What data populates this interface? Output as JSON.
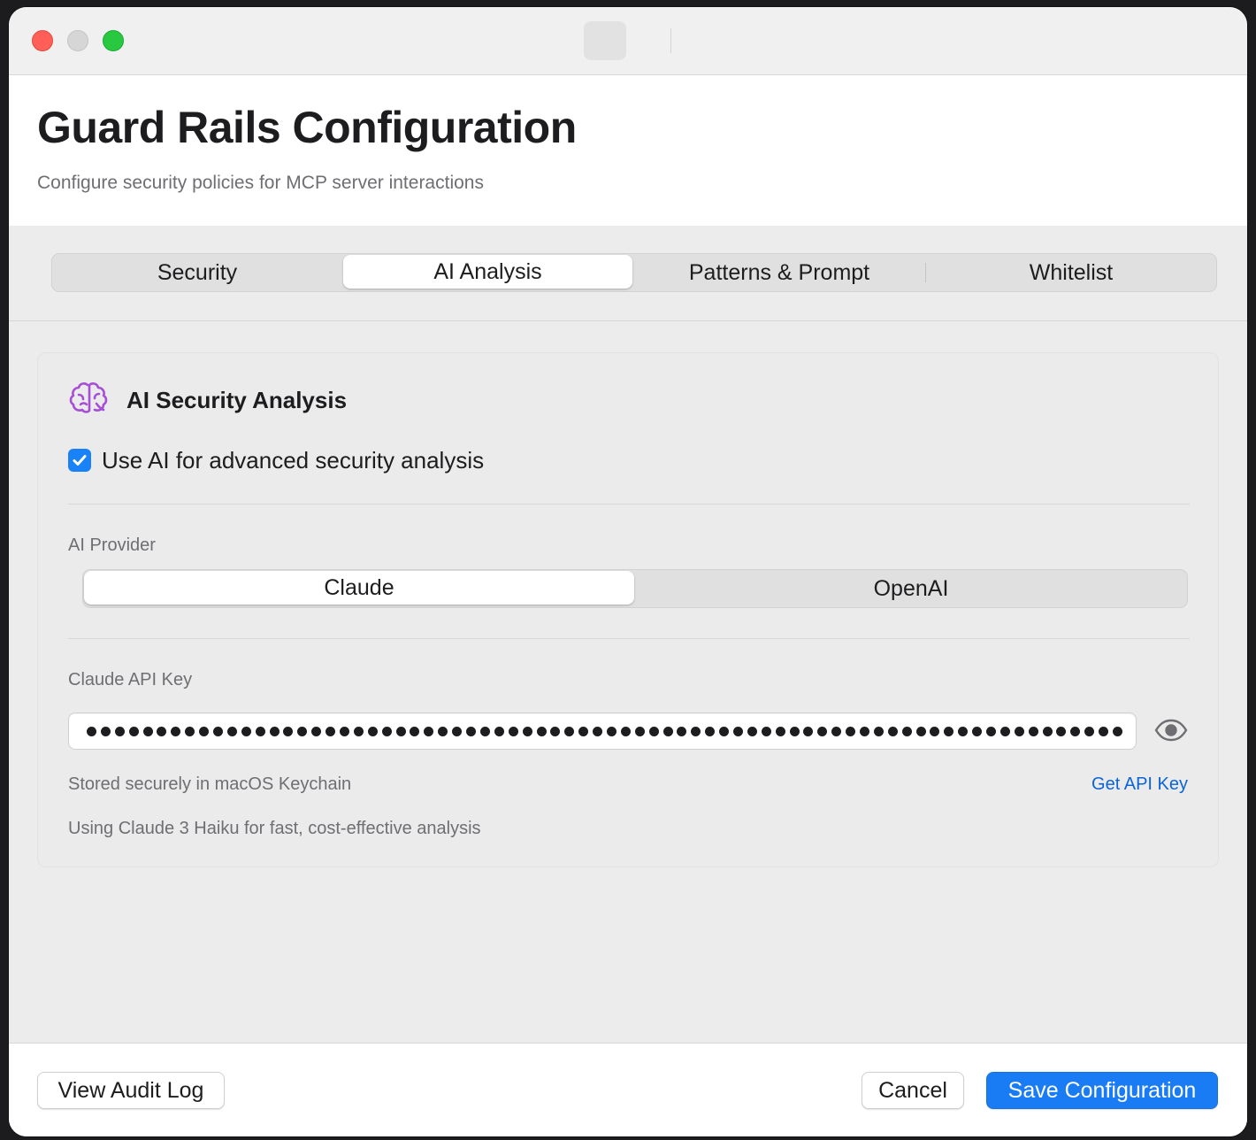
{
  "header": {
    "title": "Guard Rails Configuration",
    "subtitle": "Configure security policies for MCP server interactions"
  },
  "tabs": [
    {
      "label": "Security",
      "active": false
    },
    {
      "label": "AI Analysis",
      "active": true
    },
    {
      "label": "Patterns & Prompt",
      "active": false
    },
    {
      "label": "Whitelist",
      "active": false
    }
  ],
  "card": {
    "icon": "brain-icon",
    "title": "AI Security Analysis",
    "use_ai": {
      "label": "Use AI for advanced security analysis",
      "checked": true
    },
    "provider_label": "AI Provider",
    "providers": [
      {
        "label": "Claude",
        "selected": true
      },
      {
        "label": "OpenAI",
        "selected": false
      }
    ],
    "api_key_label": "Claude API Key",
    "api_key_masked": "••••••••••••••••••••••••••••••••••••••••••••••••••••••••••••••••••••••••••",
    "reveal_icon": "eye-icon",
    "keychain_note": "Stored securely in macOS Keychain",
    "get_key_link": "Get API Key",
    "model_note": "Using Claude 3 Haiku for fast, cost-effective analysis"
  },
  "footer": {
    "audit_button": "View Audit Log",
    "cancel_button": "Cancel",
    "save_button": "Save Configuration"
  },
  "colors": {
    "accent": "#1a7cf4",
    "icon_purple": "#a64fd6",
    "link": "#0a64d6"
  }
}
